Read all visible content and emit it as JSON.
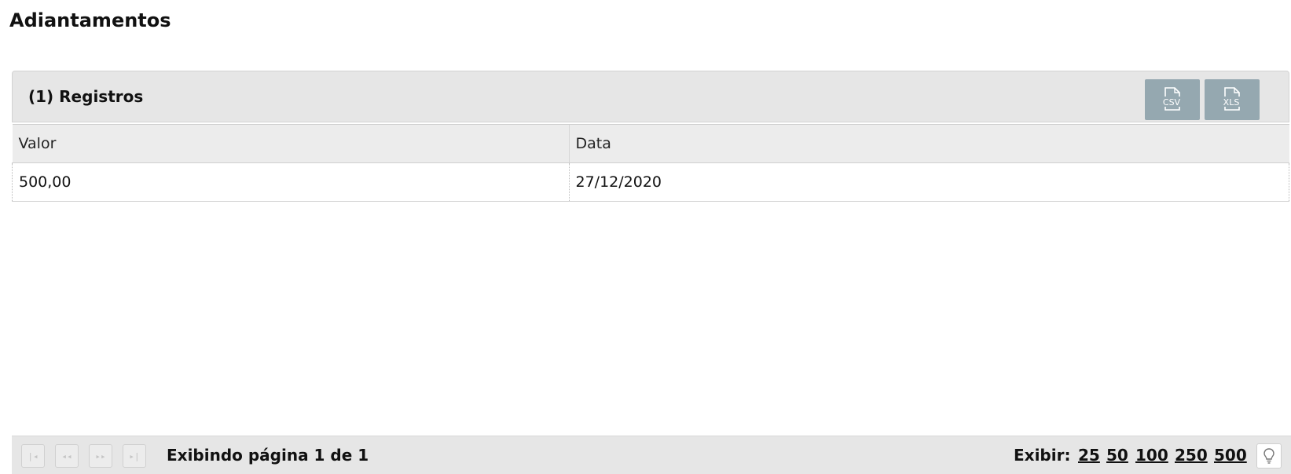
{
  "page": {
    "title": "Adiantamentos"
  },
  "panel": {
    "title": "(1) Registros",
    "export": [
      {
        "label": "CSV",
        "icon": "csv-file-icon"
      },
      {
        "label": "XLS",
        "icon": "xls-file-icon"
      }
    ]
  },
  "table": {
    "columns": [
      "Valor",
      "Data"
    ],
    "rows": [
      [
        "500,00",
        "27/12/2020"
      ]
    ]
  },
  "pager": {
    "buttons": [
      {
        "icon": "first-page-icon",
        "glyph": "|◂"
      },
      {
        "icon": "prev-page-icon",
        "glyph": "◂◂"
      },
      {
        "icon": "next-page-icon",
        "glyph": "▸▸"
      },
      {
        "icon": "last-page-icon",
        "glyph": "▸|"
      }
    ],
    "status": "Exibindo página 1 de 1",
    "show_label": "Exibir:",
    "page_sizes": [
      "25",
      "50",
      "100",
      "250",
      "500"
    ],
    "hint_icon": "lightbulb-icon"
  },
  "colors": {
    "header_bg": "#e6e6e6",
    "export_button": "#95a8b0",
    "text": "#111111"
  }
}
